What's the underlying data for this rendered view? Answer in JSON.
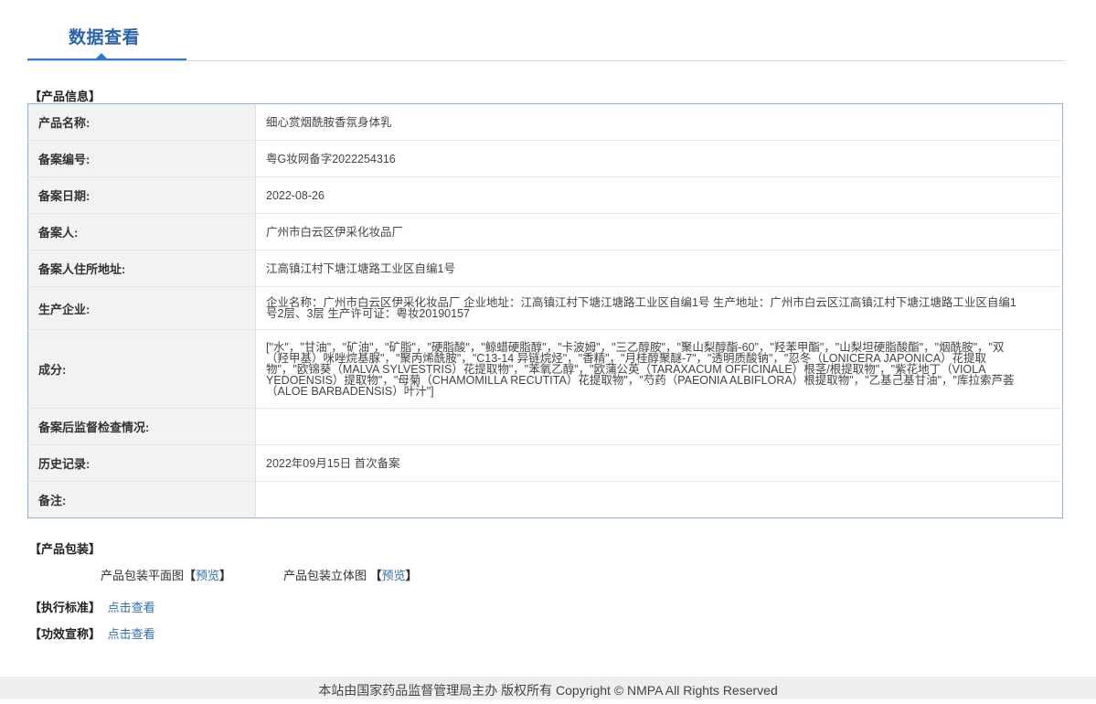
{
  "tab": {
    "title": "数据查看"
  },
  "product_section_title": "【产品信息】",
  "rows": [
    {
      "label": "产品名称:",
      "value": "细心赏烟酰胺香氛身体乳"
    },
    {
      "label": "备案编号:",
      "value": "粤G妆网备字2022254316"
    },
    {
      "label": "备案日期:",
      "value": "2022-08-26"
    },
    {
      "label": "备案人:",
      "value": "广州市白云区伊采化妆品厂"
    },
    {
      "label": "备案人住所地址:",
      "value": "江高镇江村下塘江塘路工业区自编1号"
    },
    {
      "label": "生产企业:",
      "value": "企业名称：广州市白云区伊采化妆品厂 企业地址：江高镇江村下塘江塘路工业区自编1号 生产地址：广州市白云区江高镇江村下塘江塘路工业区自编1号2层、3层 生产许可证：粤妆20190157"
    },
    {
      "label": "成分:",
      "value": "[\"水\"，\"甘油\"，\"矿油\"，\"矿脂\"，\"硬脂酸\"，\"鲸蜡硬脂醇\"，\"卡波姆\"，\"三乙醇胺\"，\"聚山梨醇酯-60\"，\"羟苯甲酯\"，\"山梨坦硬脂酸酯\"，\"烟酰胺\"，\"双（羟甲基）咪唑烷基脲\"，\"聚丙烯酰胺\"，\"C13-14 异链烷烃\"，\"香精\"，\"月桂醇聚醚-7\"，\"透明质酸钠\"，\"忍冬（LONICERA JAPONICA）花提取物\"，\"欧锦葵（MALVA SYLVESTRIS）花提取物\"，\"苯氧乙醇\"，\"欧蒲公英（TARAXACUM OFFICINALE）根茎/根提取物\"，\"紫花地丁（VIOLA YEDOENSIS）提取物\"，\"母菊（CHAMOMILLA RECUTITA）花提取物\"，\"芍药（PAEONIA ALBIFLORA）根提取物\"，\"乙基己基甘油\"，\"库拉索芦荟（ALOE BARBADENSIS）叶汁\"]"
    },
    {
      "label": "备案后监督检查情况:",
      "value": ""
    },
    {
      "label": "历史记录:",
      "value": "2022年09月15日 首次备案"
    },
    {
      "label": "备注:",
      "value": ""
    }
  ],
  "packaging": {
    "title": "【产品包装】",
    "flat_label": "产品包装平面图",
    "flat_link": "预览",
    "solid_label": "产品包装立体图",
    "solid_link": "预览",
    "bracket_open": "【",
    "bracket_close": "】"
  },
  "standard": {
    "label": "【执行标准】",
    "link": "点击查看"
  },
  "efficacy": {
    "label": "【功效宣称】",
    "link": "点击查看"
  },
  "footer": {
    "text": "本站由国家药品监督管理局主办 版权所有 Copyright © NMPA All Rights Reserved"
  }
}
